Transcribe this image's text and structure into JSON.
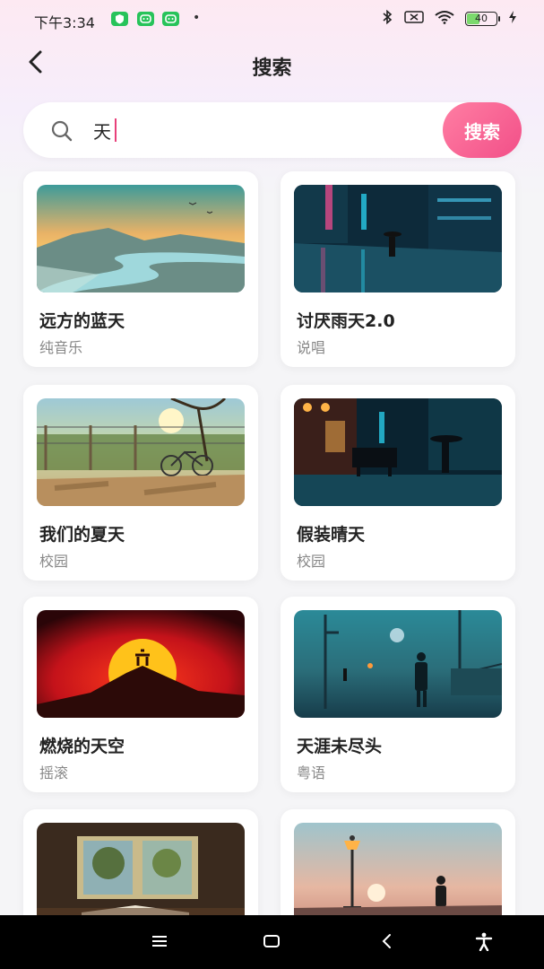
{
  "status_bar": {
    "time": "下午3:34",
    "dot": "•",
    "battery": "40",
    "icons": [
      "shield-app-icon",
      "android-app-icon",
      "android-app-icon",
      "bluetooth-icon",
      "sim-x-icon",
      "wifi-icon",
      "battery-icon",
      "charging-icon"
    ]
  },
  "header": {
    "title": "搜索",
    "back_icon": "chevron-left-icon"
  },
  "search": {
    "value": "天",
    "button_label": "搜索",
    "icon": "search-icon"
  },
  "results": [
    {
      "title": "远方的蓝天",
      "tag": "纯音乐",
      "image": "sunset-river-landscape"
    },
    {
      "title": "讨厌雨天2.0",
      "tag": "说唱",
      "image": "neon-rainy-city-street"
    },
    {
      "title": "我们的夏天",
      "tag": "校园",
      "image": "sunlit-fence-bicycle"
    },
    {
      "title": "假装晴天",
      "tag": "校园",
      "image": "rainy-night-street-piano"
    },
    {
      "title": "燃烧的天空",
      "tag": "摇滚",
      "image": "red-sky-mountain-silhouette"
    },
    {
      "title": "天涯未尽头",
      "tag": "粤语",
      "image": "foggy-street-lone-figure"
    },
    {
      "title": "",
      "tag": "",
      "image": "window-open-book"
    },
    {
      "title": "",
      "tag": "",
      "image": "streetlamp-sunset-figure"
    }
  ],
  "nav_bar": {
    "icons": [
      "menu-icon",
      "home-square-icon",
      "back-triangle-icon",
      "accessibility-icon"
    ]
  },
  "colors": {
    "accent": "#f24f88",
    "caret": "#e8407a",
    "card_bg": "#ffffff",
    "page_bg": "#f5f5f7"
  }
}
